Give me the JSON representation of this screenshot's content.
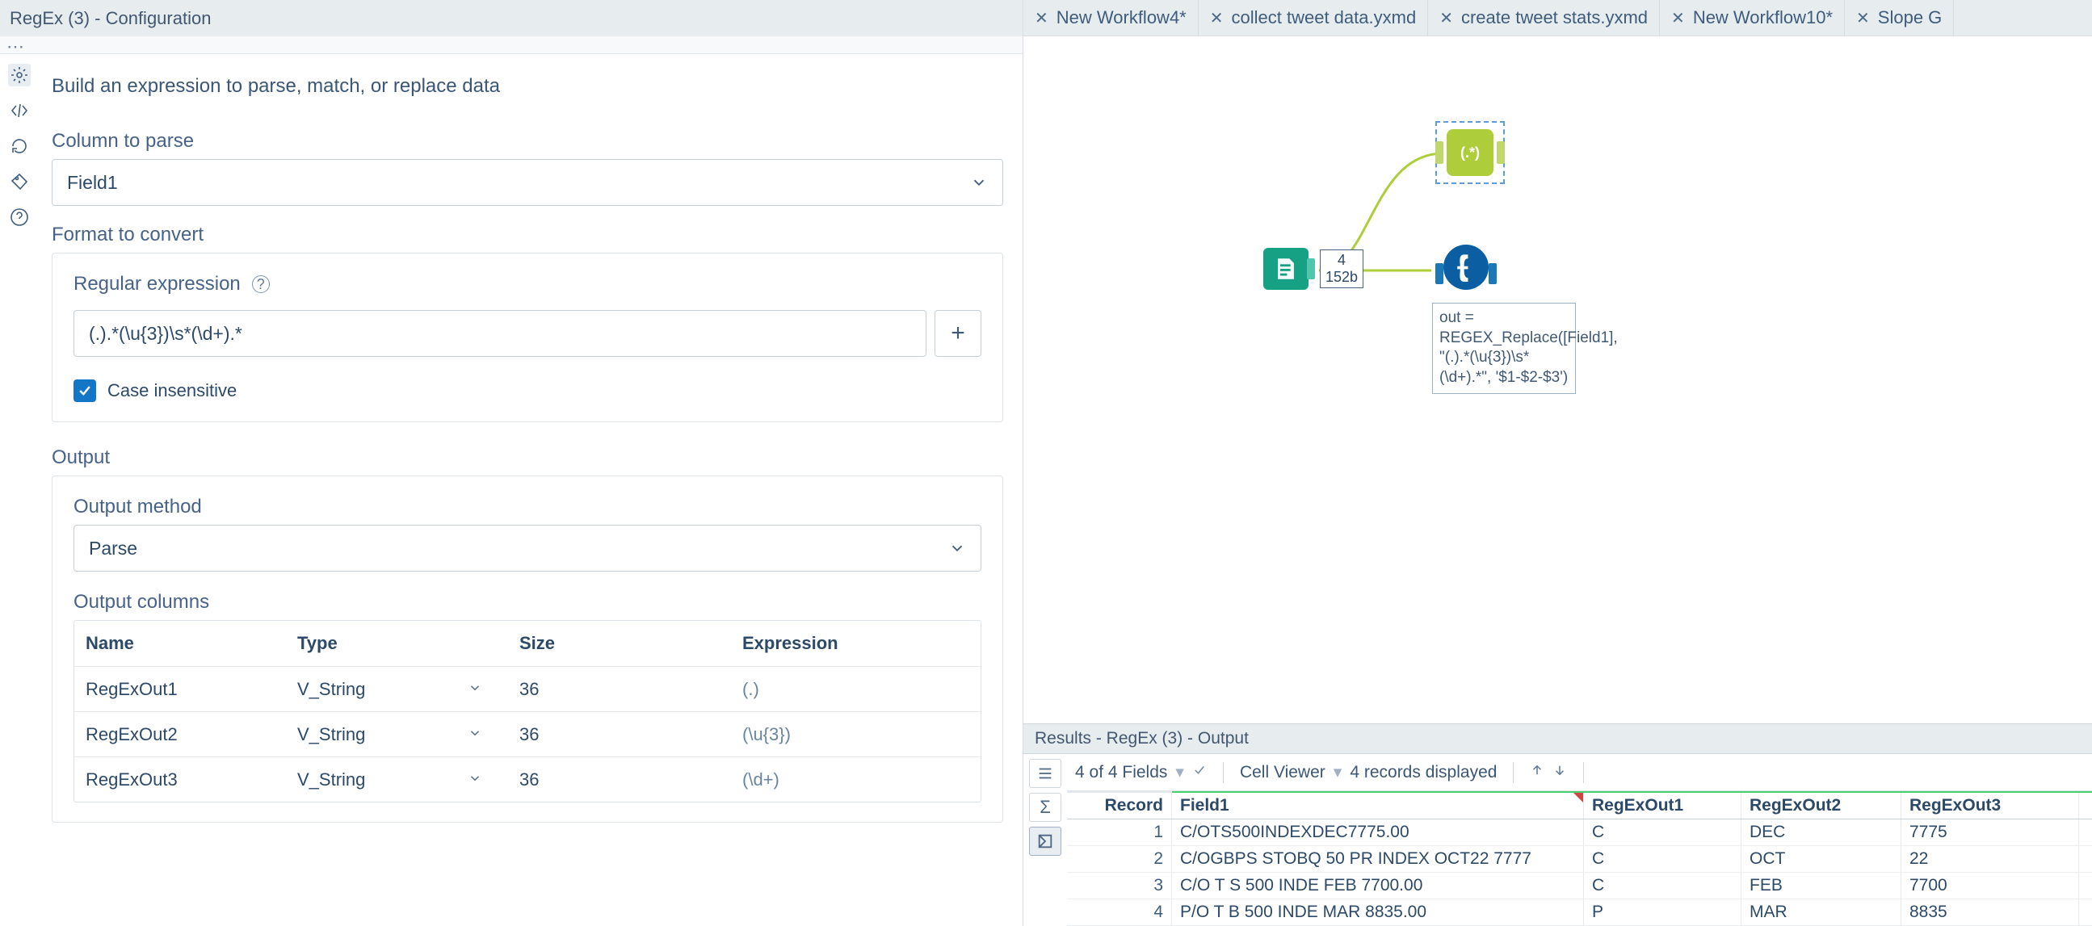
{
  "panel": {
    "title": "RegEx (3) - Configuration",
    "lead": "Build an expression to parse, match, or replace data",
    "column_label": "Column to parse",
    "column_value": "Field1",
    "format_label": "Format to convert",
    "regex_label": "Regular expression",
    "regex_value": "(.).*(\\u{3})\\s*(\\d+).*",
    "case_label": "Case insensitive",
    "output_label": "Output",
    "output_method_label": "Output method",
    "output_method_value": "Parse",
    "output_columns_label": "Output columns",
    "columns_hdr": {
      "name": "Name",
      "type": "Type",
      "size": "Size",
      "expr": "Expression"
    },
    "columns": [
      {
        "name": "RegExOut1",
        "type": "V_String",
        "size": "36",
        "expr": "(.)"
      },
      {
        "name": "RegExOut2",
        "type": "V_String",
        "size": "36",
        "expr": "(\\u{3})"
      },
      {
        "name": "RegExOut3",
        "type": "V_String",
        "size": "36",
        "expr": "(\\d+)"
      }
    ]
  },
  "tabs": [
    {
      "label": "New Workflow4*"
    },
    {
      "label": "collect tweet data.yxmd"
    },
    {
      "label": "create tweet stats.yxmd"
    },
    {
      "label": "New Workflow10*"
    },
    {
      "label": "Slope G"
    }
  ],
  "canvas": {
    "badge_top": "4",
    "badge_bottom": "152b",
    "regex_icon_label": "(.*)",
    "annotation": "out = REGEX_Replace([Field1], \"(.).*(\\u{3})\\s*(\\d+).*\", '$1-$2-$3')"
  },
  "results": {
    "title": "Results - RegEx (3) - Output",
    "fields_summary": "4 of 4 Fields",
    "cellviewer": "Cell Viewer",
    "records_summary": "4 records displayed",
    "headers": {
      "record": "Record",
      "f1": "Field1",
      "r1": "RegExOut1",
      "r2": "RegExOut2",
      "r3": "RegExOut3"
    },
    "rows": [
      {
        "n": "1",
        "f1": "C/OTS500INDEXDEC7775.00",
        "r1": "C",
        "r2": "DEC",
        "r3": "7775"
      },
      {
        "n": "2",
        "f1": "C/OGBPS STOBQ 50 PR INDEX OCT22 7777",
        "r1": "C",
        "r2": "OCT",
        "r3": "22"
      },
      {
        "n": "3",
        "f1": "C/O T S 500 INDE FEB 7700.00",
        "r1": "C",
        "r2": "FEB",
        "r3": "7700"
      },
      {
        "n": "4",
        "f1": "P/O T B 500 INDE MAR 8835.00",
        "r1": "P",
        "r2": "MAR",
        "r3": "8835"
      }
    ]
  }
}
